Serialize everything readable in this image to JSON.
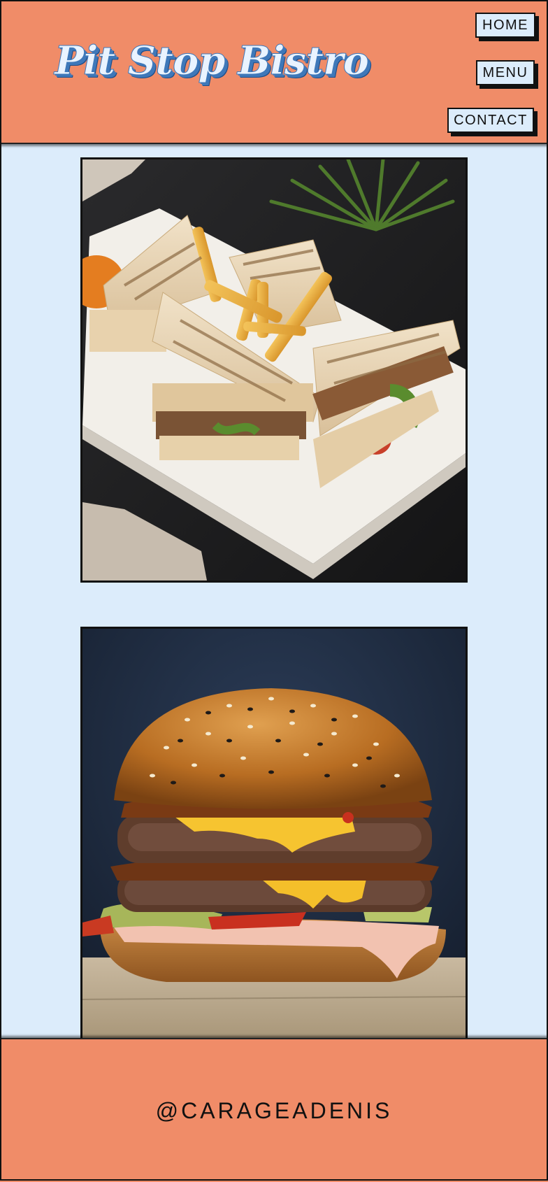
{
  "header": {
    "logo": "Pit Stop Bistro",
    "nav": {
      "home": "HOME",
      "menu": "MENU",
      "contact": "CONTACT"
    }
  },
  "gallery": {
    "items": [
      {
        "subject": "grilled club sandwich with fries"
      },
      {
        "subject": "double cheeseburger"
      }
    ]
  },
  "footer": {
    "credit": "@CARAGEADENIS"
  },
  "colors": {
    "brand_orange": "#f08c68",
    "page_background": "#dcecfb",
    "logo_blue": "#3f78b9",
    "border": "#111111"
  }
}
